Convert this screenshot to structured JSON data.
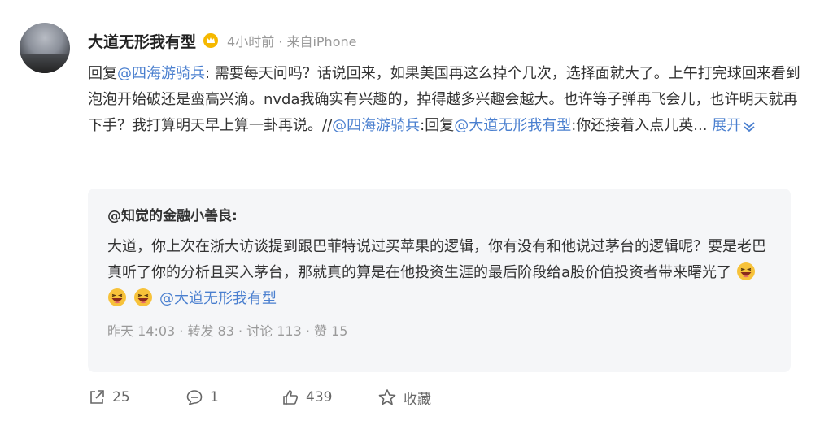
{
  "post": {
    "author": "大道无形我有型",
    "meta": "4小时前 · 来自iPhone",
    "content": {
      "reply_prefix": "回复",
      "reply_mention": "@四海游骑兵",
      "text": ": 需要每天问吗？话说回来，如果美国再这么掉个几次，选择面就大了。上午打完球回来看到泡泡开始破还是蛮高兴滴。nvda我确实有兴趣的，掉得越多兴趣会越大。也许等子弹再飞会儿，也许明天就再下手？我打算明天早上算一卦再说。//",
      "mention2": "@四海游骑兵",
      "text2": ":回复",
      "mention3": "@大道无形我有型",
      "text3": ":你还接着入点儿英...",
      "expand_label": "展开"
    }
  },
  "quote": {
    "author": "@知觉的金融小善良:",
    "body": "大道，你上次在浙大访谈提到跟巴菲特说过买苹果的逻辑，你有没有和他说过茅台的逻辑呢？要是老巴真听了你的分析且买入茅台，那就真的算是在他投资生涯的最后阶段给a股价值投资者带来曙光了",
    "mention": "@大道无形我有型",
    "meta": "昨天 14:03  · 转发 83 · 讨论 113 · 赞 15"
  },
  "actions": {
    "share_count": "25",
    "comment_count": "1",
    "like_count": "439",
    "favorite_label": "收藏"
  },
  "icons": {
    "vip": "crown-badge-icon",
    "share": "share-icon",
    "comment": "comment-icon",
    "like": "thumbs-up-icon",
    "favorite": "star-icon",
    "expand": "chevron-down-icon",
    "emoji": "laughing-emoji-icon"
  },
  "colors": {
    "link": "#4a7fcf",
    "meta": "#999999",
    "quote_bg": "#f5f6f8",
    "vip_gold": "#f5b800"
  }
}
